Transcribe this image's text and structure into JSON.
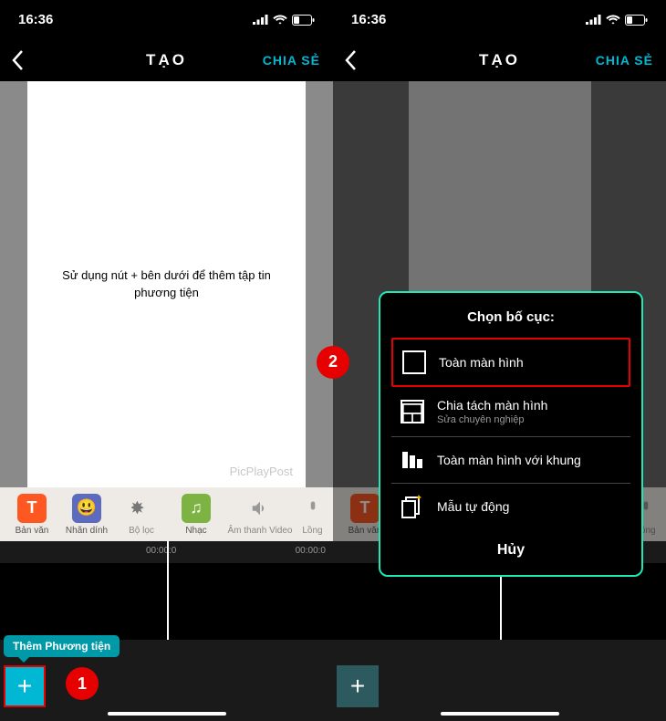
{
  "status": {
    "time": "16:36"
  },
  "nav": {
    "title": "TẠO",
    "share": "CHIA SẺ"
  },
  "canvas": {
    "instruction": "Sử dụng nút + bên dưới để thêm tập tin phương tiện",
    "watermark": "PicPlayPost"
  },
  "toolbar": {
    "text": "Bản văn",
    "sticker": "Nhãn dính",
    "filter": "Bộ lọc",
    "music": "Nhạc",
    "audio": "Âm thanh Video",
    "voice": "Lồng"
  },
  "timeline": {
    "t0": "00:00:0",
    "t1": "00:00:0"
  },
  "add": {
    "tooltip": "Thêm Phương tiện",
    "plus": "+"
  },
  "steps": {
    "one": "1",
    "two": "2"
  },
  "popup": {
    "title": "Chọn bố cục:",
    "fullscreen": "Toàn màn hình",
    "split": "Chia tách màn hình",
    "split_sub": "Sửa chuyên nghiệp",
    "framed": "Toàn màn hình với khung",
    "auto": "Mẫu tự động",
    "cancel": "Hủy"
  }
}
